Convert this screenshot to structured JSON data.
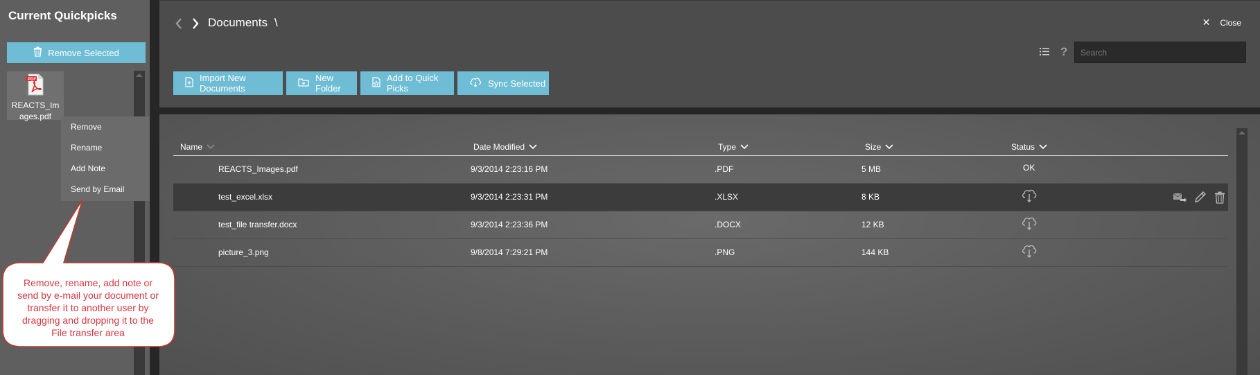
{
  "quickpicks": {
    "title": "Current Quickpicks",
    "remove_selected_label": "Remove Selected",
    "file_name": "REACTS_Images.pdf",
    "context_menu": [
      "Remove",
      "Rename",
      "Add Note",
      "Send by Email"
    ]
  },
  "callout": {
    "text": "Remove, rename, add note or send by e-mail your document or transfer it to another user by dragging and dropping it to the File transfer area"
  },
  "header": {
    "breadcrumb": "Documents",
    "breadcrumb_separator": "\\",
    "close_label": "Close",
    "close_glyph": "✕",
    "search_placeholder": "Search",
    "help_glyph": "?"
  },
  "toolbar": {
    "import_label": "Import New Documents",
    "new_folder_label": "New Folder",
    "add_quick_picks_label": "Add to Quick Picks",
    "sync_selected_label": "Sync Selected"
  },
  "table": {
    "columns": [
      "Name",
      "Date Modified",
      "Type",
      "Size",
      "Status"
    ],
    "rows": [
      {
        "name": "REACTS_Images.pdf",
        "date": "9/3/2014 2:23:16 PM",
        "type": ".PDF",
        "size": "5 MB",
        "status": "OK",
        "status_icon": "text",
        "selected": false
      },
      {
        "name": "test_excel.xlsx",
        "date": "9/3/2014 2:23:31 PM",
        "type": ".XLSX",
        "size": "8 KB",
        "status": "",
        "status_icon": "cloud-download-icon",
        "selected": true
      },
      {
        "name": "test_file transfer.docx",
        "date": "9/3/2014 2:23:36 PM",
        "type": ".DOCX",
        "size": "12 KB",
        "status": "",
        "status_icon": "cloud-download-icon",
        "selected": false
      },
      {
        "name": "picture_3.png",
        "date": "9/8/2014 7:29:21 PM",
        "type": ".PNG",
        "size": "144 KB",
        "status": "",
        "status_icon": "cloud-download-icon",
        "selected": false
      }
    ]
  },
  "colors": {
    "accent_button": "#6fbdd5",
    "callout_text": "#d9363e",
    "callout_border": "#c0392b"
  }
}
